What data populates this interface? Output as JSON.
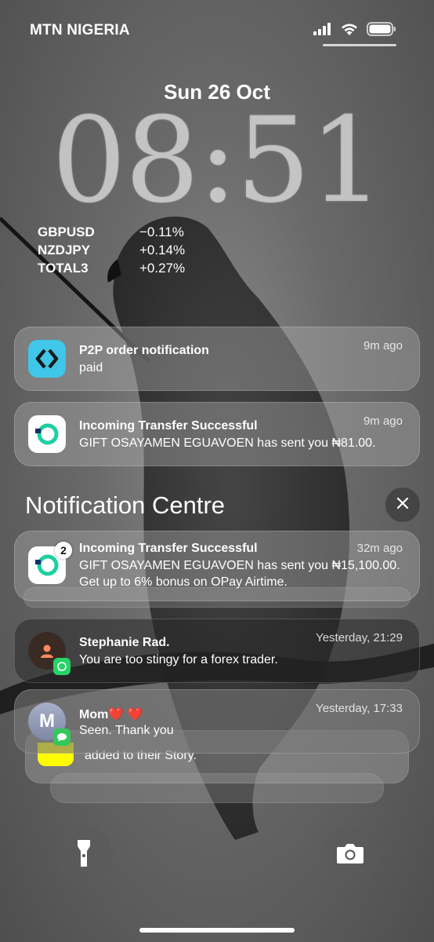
{
  "status_bar": {
    "carrier": "MTN NIGERIA",
    "signal_icon": "signal-bars-icon",
    "wifi_icon": "wifi-icon",
    "battery_icon": "battery-icon"
  },
  "lock_screen": {
    "date": "Sun 26 Oct",
    "time": "08:51"
  },
  "forex_widget": {
    "rows": [
      {
        "symbol": "GBPUSD",
        "change": "−0.11%"
      },
      {
        "symbol": "NZDJPY",
        "change": "+0.14%"
      },
      {
        "symbol": "TOTAL3",
        "change": "+0.27%"
      }
    ]
  },
  "notifications_top": [
    {
      "title": "P2P order notification",
      "body": "paid",
      "time": "9m ago",
      "icon": "bybit-app-icon",
      "icon_color": "#3fc6e8"
    },
    {
      "title": "Incoming Transfer Successful",
      "body": "GIFT OSAYAMEN EGUAVOEN has sent you ₦81.00.",
      "time": "9m ago",
      "icon": "opay-app-icon",
      "icon_color": "#1dcf9f"
    }
  ],
  "notification_centre": {
    "title": "Notification Centre",
    "close_icon": "close-icon",
    "items": [
      {
        "title": "Incoming Transfer Successful",
        "body": "GIFT OSAYAMEN EGUAVOEN has sent you ₦15,100.00. Get up to 6% bonus on OPay Airtime.",
        "time": "32m ago",
        "badge": "2",
        "icon": "opay-app-icon"
      },
      {
        "title": "Stephanie Rad.",
        "body": "You are too stingy for a forex trader.",
        "time": "Yesterday, 21:29",
        "icon": "contact-avatar-icon",
        "sub_icon": "whatsapp-icon"
      },
      {
        "title": "Mom❤️ ❤️",
        "body": "Seen. Thank you",
        "time": "Yesterday, 17:33",
        "avatar_letter": "M",
        "sub_icon": "messages-icon"
      }
    ],
    "stacked_hint": "added to their Story."
  },
  "quick_actions": {
    "flashlight_icon": "flashlight-icon",
    "camera_icon": "camera-icon"
  },
  "colors": {
    "opay_green": "#1dcf9f",
    "opay_navy": "#1a2b6d",
    "bybit_cyan": "#3fc6e8",
    "whatsapp_green": "#25d366",
    "messages_green": "#34c759",
    "snapchat_yellow": "#fffc00"
  }
}
